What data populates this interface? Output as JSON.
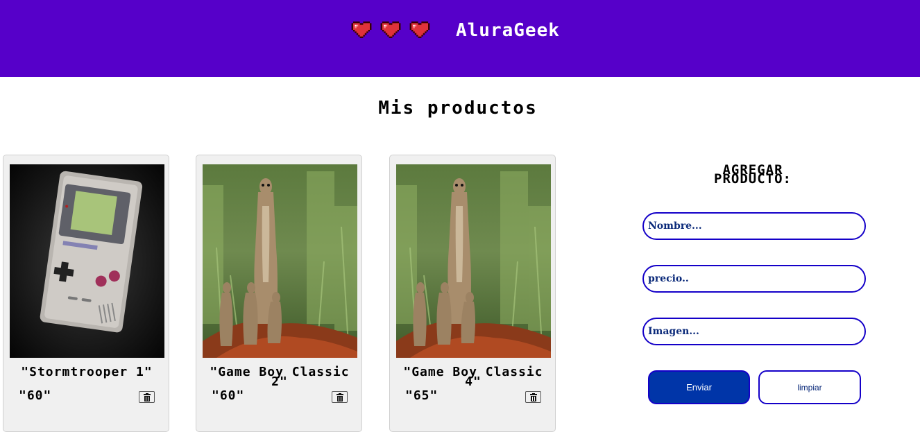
{
  "header": {
    "brand": "AluraGeek",
    "hearts_icon": "pixel-heart-icon"
  },
  "main": {
    "title": "Mis productos"
  },
  "products": [
    {
      "name": "\"Stormtrooper 1\"",
      "price": "\"60\"",
      "image": "game-boy-console"
    },
    {
      "name": "\"Game Boy Classic 2\"",
      "price": "\"60\"",
      "image": "meerkats-photo"
    },
    {
      "name": "\"Game Boy Classic 4\"",
      "price": "\"65\"",
      "image": "meerkats-photo"
    }
  ],
  "form": {
    "title": "AGREGAR PRODUCTO:",
    "name_placeholder": "Nombre...",
    "price_placeholder": "precio..",
    "image_placeholder": "Imagen...",
    "submit_label": "Enviar",
    "clear_label": "limpiar"
  },
  "colors": {
    "header": "#5600c9",
    "primary": "#0035a8",
    "border": "#1400c8"
  }
}
